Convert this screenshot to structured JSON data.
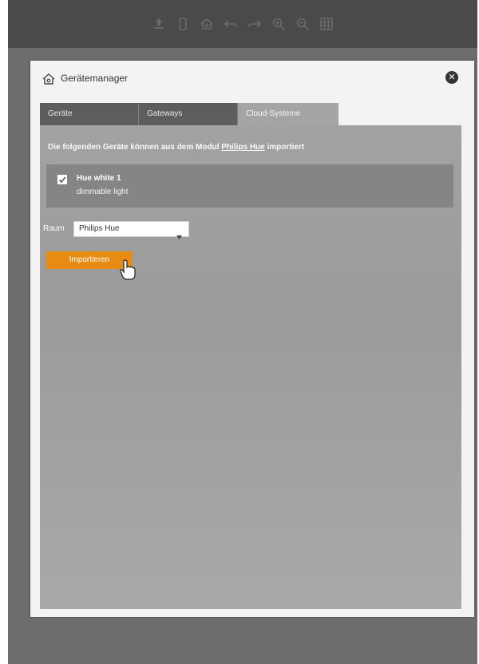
{
  "toolbar": {
    "icons": [
      "upload-icon",
      "mobile-icon",
      "home-icon",
      "undo-icon",
      "redo-icon",
      "zoom-in-icon",
      "zoom-out-icon",
      "grid-icon"
    ]
  },
  "dialog": {
    "title": "Gerätemanager",
    "close_glyph": "✕"
  },
  "tabs": [
    {
      "label": "Geräte",
      "active": false
    },
    {
      "label": "Gateways",
      "active": false
    },
    {
      "label": "Cloud-Systeme",
      "active": true
    }
  ],
  "cloud": {
    "intro_prefix": "Die folgenden Geräte können aus dem Modul ",
    "module_link": "Philips Hue",
    "intro_suffix": " importiert",
    "device": {
      "name": "Hue white 1",
      "type": "dimmable light",
      "checked": true
    },
    "room_label": "Raum",
    "room_value": "Philips Hue",
    "import_label": "Importieren"
  },
  "colors": {
    "accent": "#e78b12",
    "toolbar": "#4a4a4a",
    "panel": "#a2a2a2",
    "device_box": "#858585"
  }
}
